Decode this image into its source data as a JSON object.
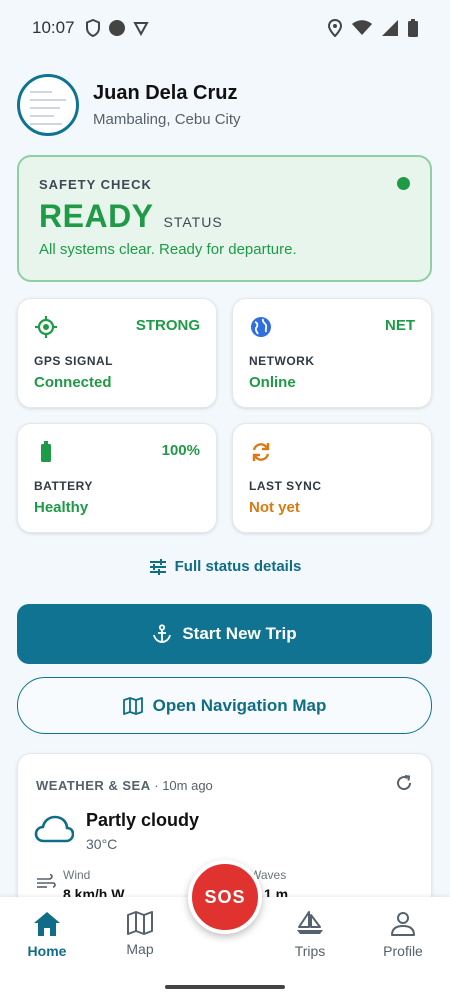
{
  "status_bar": {
    "time": "10:07"
  },
  "profile": {
    "name": "Juan Dela Cruz",
    "location": "Mambaling, Cebu City"
  },
  "safety_check": {
    "label": "SAFETY CHECK",
    "status": "READY",
    "status_label": "STATUS",
    "message": "All systems clear. Ready for departure.",
    "indicator_color": "#1f9a46"
  },
  "tiles": {
    "gps": {
      "value": "STRONG",
      "caption": "GPS SIGNAL",
      "state": "Connected",
      "icon": "gps-target-icon"
    },
    "network": {
      "value": "NET",
      "caption": "NETWORK",
      "state": "Online",
      "icon": "globe-icon"
    },
    "battery": {
      "value": "100%",
      "caption": "BATTERY",
      "state": "Healthy",
      "icon": "battery-icon"
    },
    "sync": {
      "value": "",
      "caption": "LAST SYNC",
      "state": "Not yet",
      "icon": "sync-icon"
    }
  },
  "full_status_link": "Full status details",
  "buttons": {
    "start_trip": "Start New Trip",
    "open_map": "Open Navigation Map"
  },
  "weather": {
    "title": "WEATHER & SEA",
    "updated": "· 10m ago",
    "condition": "Partly cloudy",
    "temperature": "30°C",
    "wind_label": "Wind",
    "wind_value": "8 km/h W",
    "waves_label": "Waves",
    "waves_value": "1 m"
  },
  "sos": {
    "label": "SOS",
    "color": "#e0322f"
  },
  "nav": {
    "items": [
      {
        "label": "Home",
        "icon": "home-icon"
      },
      {
        "label": "Map",
        "icon": "map-icon"
      },
      {
        "label": "Trips",
        "icon": "sailboat-icon"
      },
      {
        "label": "Profile",
        "icon": "person-icon"
      }
    ]
  },
  "colors": {
    "primary": "#0f7391",
    "success": "#1f9a46",
    "warning": "#d97a12"
  }
}
